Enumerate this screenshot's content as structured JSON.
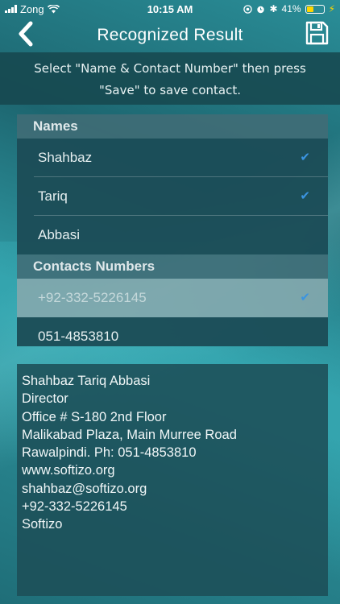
{
  "status": {
    "carrier": "Zong",
    "time": "10:15 AM",
    "battery": "41%",
    "battery_level": 0.41
  },
  "nav": {
    "title": "Recognized Result",
    "back_icon": "chevron-left-icon",
    "save_icon": "floppy-disk-icon"
  },
  "instruction": "Select \"Name & Contact Number\" then press \"Save\" to save contact.",
  "names_section": {
    "header": "Names",
    "items": [
      {
        "label": "Shahbaz",
        "checked": true
      },
      {
        "label": "Tariq",
        "checked": true
      },
      {
        "label": "Abbasi",
        "checked": false
      }
    ]
  },
  "contacts_section": {
    "header": "Contacts Numbers",
    "items": [
      {
        "label": "+92-332-5226145",
        "checked": true,
        "selected": true
      },
      {
        "label": "051-4853810",
        "checked": false
      }
    ]
  },
  "recognized_text": "Shahbaz Tariq Abbasi\nDirector\nOffice # S-180 2nd Floor\nMalikabad Plaza, Main Murree Road\nRawalpindi. Ph: 051-4853810\nwww.softizo.org\nshahbaz@softizo.org\n+92-332-5226145\nSoftizo",
  "colors": {
    "accent_check": "#3b94e0",
    "battery": "#ffd500"
  }
}
